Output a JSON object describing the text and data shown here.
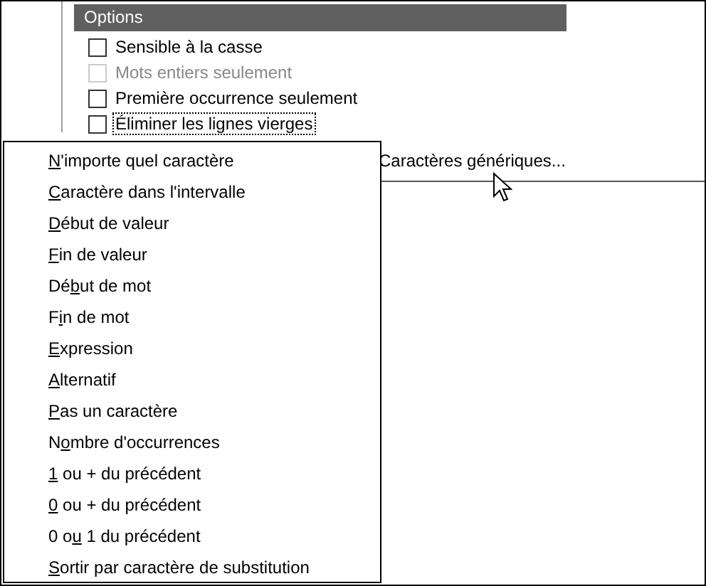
{
  "options": {
    "title": "Options",
    "checkboxes": [
      {
        "label": "Sensible à la casse",
        "checked": false,
        "disabled": false,
        "focused": false
      },
      {
        "label": "Mots entiers seulement",
        "checked": false,
        "disabled": true,
        "focused": false
      },
      {
        "label": "Première occurrence seulement",
        "checked": false,
        "disabled": false,
        "focused": false
      },
      {
        "label": "Éliminer les lignes vierges",
        "checked": false,
        "disabled": false,
        "focused": true
      }
    ]
  },
  "wildcards_button": {
    "label": "Caractères génériques..."
  },
  "menu": {
    "items": [
      {
        "accel": "N",
        "after": "'importe quel caractère"
      },
      {
        "accel": "C",
        "after": "aractère dans l'intervalle"
      },
      {
        "accel": "D",
        "after": "ébut de valeur"
      },
      {
        "accel": "F",
        "after": "in de valeur"
      },
      {
        "before": "Dé",
        "accel": "b",
        "after": "ut de mot"
      },
      {
        "before": "F",
        "accel": "i",
        "after": "n de mot"
      },
      {
        "accel": "E",
        "after": "xpression"
      },
      {
        "accel": "A",
        "after": "lternatif"
      },
      {
        "accel": "P",
        "after": "as un caractère"
      },
      {
        "before": "N",
        "accel": "o",
        "after": "mbre d'occurrences"
      },
      {
        "accel": "1",
        "after": " ou + du précédent"
      },
      {
        "accel": "0",
        "after": " ou + du précédent"
      },
      {
        "before": "0 o",
        "accel": "u",
        "after": " 1 du précédent"
      },
      {
        "accel": "S",
        "after": "ortir par caractère de substitution"
      }
    ]
  }
}
